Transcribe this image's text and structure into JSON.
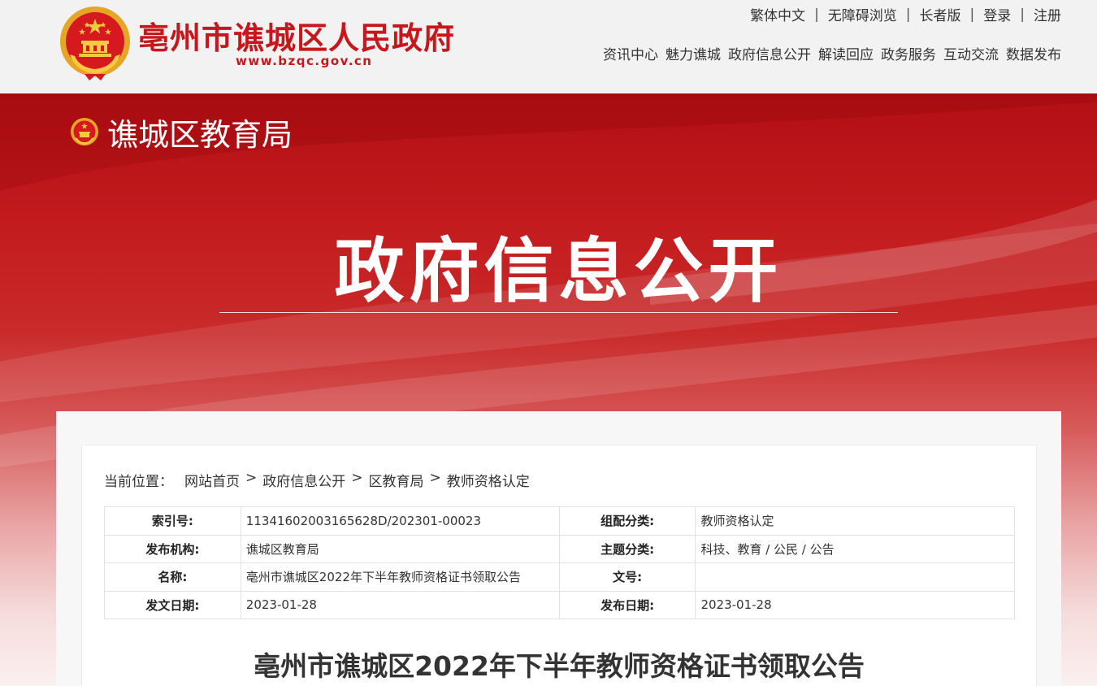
{
  "header": {
    "site_title": "亳州市谯城区人民政府",
    "site_url": "www.bzqc.gov.cn",
    "utility_links": [
      "繁体中文",
      "无障碍浏览",
      "长者版",
      "登录",
      "注册"
    ],
    "nav": [
      "资讯中心",
      "魅力谯城",
      "政府信息公开",
      "解读回应",
      "政务服务",
      "互动交流",
      "数据发布"
    ]
  },
  "banner": {
    "department": "谯城区教育局",
    "title": "政府信息公开"
  },
  "breadcrumb": {
    "label": "当前位置：",
    "items": [
      "网站首页",
      "政府信息公开",
      "区教育局",
      "教师资格认定"
    ],
    "separator": ">"
  },
  "meta_table": {
    "rows": [
      {
        "k1": "索引号:",
        "v1": "11341602003165628D/202301-00023",
        "k2": "组配分类:",
        "v2": "教师资格认定"
      },
      {
        "k1": "发布机构:",
        "v1": "谯城区教育局",
        "k2": "主题分类:",
        "v2": "科技、教育 / 公民 / 公告"
      },
      {
        "k1": "名称:",
        "v1": "亳州市谯城区2022年下半年教师资格证书领取公告",
        "k2": "文号:",
        "v2": ""
      },
      {
        "k1": "发文日期:",
        "v1": "2023-01-28",
        "k2": "发布日期:",
        "v2": "2023-01-28"
      }
    ]
  },
  "document": {
    "title": "亳州市谯城区2022年下半年教师资格证书领取公告"
  },
  "colors": {
    "brand_red": "#c8161d",
    "banner_top": "#b20f14",
    "header_bg": "#f2f2f2"
  },
  "icons": [
    "national-emblem-icon",
    "national-emblem-small-icon"
  ]
}
